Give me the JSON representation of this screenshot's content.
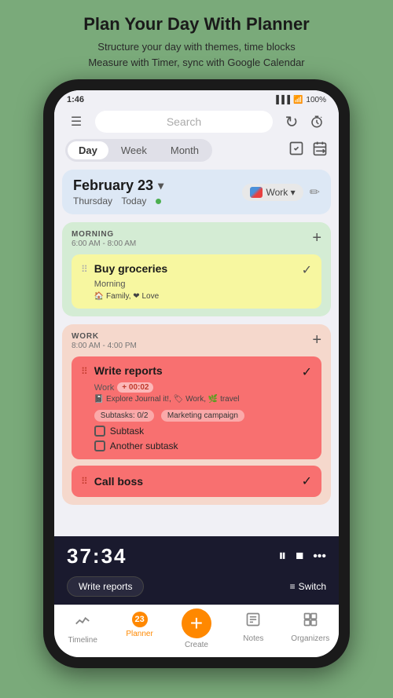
{
  "header": {
    "title": "Plan Your Day With Planner",
    "subtitle": "Structure your day with themes, time blocks\nMeasure with Timer, sync with Google Calendar"
  },
  "statusBar": {
    "time": "1:46",
    "battery": "100%",
    "signal": "▐▐▐"
  },
  "topNav": {
    "menuIcon": "☰",
    "searchPlaceholder": "Search",
    "refreshIcon": "↻",
    "timerIcon": "⏱"
  },
  "viewTabs": {
    "tabs": [
      "Day",
      "Week",
      "Month"
    ],
    "activeTab": "Day",
    "checkIcon": "☑",
    "calendarIcon": "📅"
  },
  "dateSection": {
    "date": "February 23",
    "chevron": "▾",
    "editIcon": "✏",
    "dayLabel": "Thursday",
    "todayLabel": "Today",
    "workBadge": "Work ▾"
  },
  "morningBlock": {
    "label": "MORNING",
    "time": "6:00 AM - 8:00 AM",
    "addIcon": "+",
    "task": {
      "title": "Buy groceries",
      "subtitle": "Morning",
      "tags": "🏠 Family, ❤ Love",
      "checkIcon": "✓"
    }
  },
  "workBlock": {
    "label": "WORK",
    "time": "8:00 AM - 4:00 PM",
    "addIcon": "+",
    "tasks": [
      {
        "title": "Write reports",
        "subtitle": "Work",
        "timeBadge": "+ 00:02",
        "journalTag": "Explore Journal it!",
        "workTag": "Work",
        "travelTag": "travel",
        "subtasksLabel": "Subtasks: 0/2",
        "marketingLabel": "Marketing campaign",
        "subtask1": "Subtask",
        "subtask2": "Another subtask",
        "checkIcon": "✓"
      },
      {
        "title": "Call boss",
        "checkIcon": "✓"
      }
    ]
  },
  "timerBar": {
    "time": "37:34",
    "pauseIcon": "⏸",
    "stopIcon": "⏹",
    "moreIcon": "•••",
    "taskLabel": "Write reports",
    "switchLabel": "Switch",
    "switchIcon": "≡"
  },
  "bottomNav": {
    "items": [
      {
        "icon": "〜",
        "label": "Timeline",
        "active": false
      },
      {
        "icon": "23",
        "label": "Planner",
        "active": true,
        "isBadge": true
      },
      {
        "icon": "+",
        "label": "Create",
        "isCreate": true
      },
      {
        "icon": "📝",
        "label": "Notes",
        "active": false
      },
      {
        "icon": "⊞",
        "label": "Organizers",
        "active": false
      }
    ]
  }
}
